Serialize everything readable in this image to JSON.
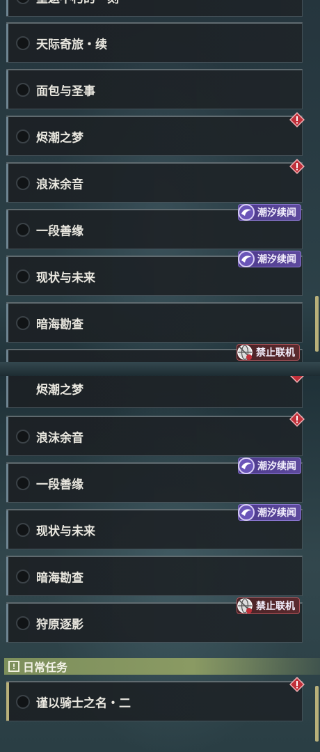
{
  "top_panel": {
    "cut_item_label": "重返不朽的一刻",
    "items": [
      {
        "label": "天际奇旅・续"
      },
      {
        "label": "面包与圣事"
      },
      {
        "label": "烬潮之梦"
      },
      {
        "label": "浪沫余音"
      },
      {
        "label": "一段善缘"
      },
      {
        "label": "现状与未来"
      },
      {
        "label": "暗海勘查"
      }
    ],
    "badges": {
      "tide_story": "潮汐续闻",
      "no_coop": "禁止联机"
    }
  },
  "bottom_panel": {
    "items": [
      {
        "label": "烬潮之梦"
      },
      {
        "label": "浪沫余音"
      },
      {
        "label": "一段善缘"
      },
      {
        "label": "现状与未来"
      },
      {
        "label": "暗海勘查"
      },
      {
        "label": "狩原逐影"
      }
    ],
    "badges": {
      "tide_story": "潮汐续闻",
      "no_coop": "禁止联机"
    },
    "daily_section": {
      "icon": "exclamation-box-icon",
      "title": "日常任务",
      "items": [
        {
          "label": "谨以骑士之名・二"
        }
      ]
    }
  },
  "colors": {
    "alert_red": "#c0303a",
    "tide_purple": "#5e4a9e",
    "no_coop_red": "#5b2a2e",
    "daily_green": "#8a9a63",
    "scroll_thumb": "#b8b07a"
  }
}
